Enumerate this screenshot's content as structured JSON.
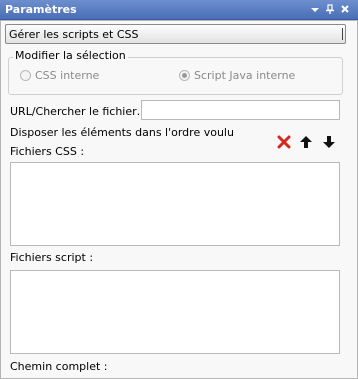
{
  "window": {
    "title": "Paramètres",
    "buttons": [
      "dropdown-arrow-icon",
      "pin-icon",
      "close-icon"
    ]
  },
  "manage_dropdown": {
    "selected": "Gérer les scripts et CSS"
  },
  "selection_group": {
    "legend": "Modifier la sélection",
    "options": [
      {
        "label": "CSS interne",
        "selected": false,
        "enabled": false
      },
      {
        "label": "Script Java interne",
        "selected": true,
        "enabled": false
      }
    ]
  },
  "url_field": {
    "label": "URL/Chercher le fichier…",
    "value": ""
  },
  "order_label": "Disposer les éléments dans l'ordre voulu",
  "toolbar": {
    "icons": [
      "delete-icon",
      "move-up-icon",
      "move-down-icon"
    ]
  },
  "css_files": {
    "label": "Fichiers CSS :",
    "items": []
  },
  "script_files": {
    "label": "Fichiers script :",
    "items": []
  },
  "full_path": {
    "label": "Chemin complet :"
  },
  "colors": {
    "titlebar": "#4a6eb6",
    "delete": "#d9261c"
  }
}
